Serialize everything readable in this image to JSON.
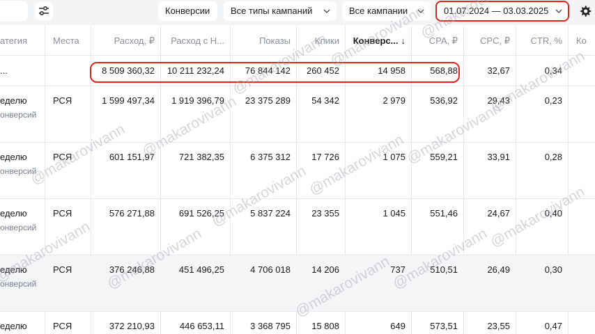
{
  "toolbar": {
    "conversions_label": "Конверсии",
    "campaign_types_label": "Все типы кампаний",
    "campaigns_label": "Все кампании",
    "date_range": "01.07.2024 — 03.03.2025"
  },
  "table": {
    "columns": [
      "атегия",
      "Места",
      "Расход, ₽",
      "Расход с Н...",
      "Показы",
      "Клики",
      "Конверс...",
      "CPA, ₽",
      "CPC, ₽",
      "CTR, %",
      "Ко"
    ],
    "sort_indicator": "↓",
    "total": {
      "strategy": "...",
      "places": "",
      "spend": "8 509 360,32",
      "spend_vat": "10 211 232,24",
      "impressions": "76 844 142",
      "clicks": "260 452",
      "conversions": "14 958",
      "cpa": "568,88",
      "cpc": "32,67",
      "ctr": "0,34"
    },
    "rows": [
      {
        "strategy": "еделю",
        "strategy_sub": "онверсий",
        "places": "РСЯ",
        "spend": "1 599 497,34",
        "spend_vat": "1 919 396,79",
        "impressions": "23 375 289",
        "clicks": "54 342",
        "conversions": "2 979",
        "cpa": "536,92",
        "cpc": "29,43",
        "ctr": "0,23"
      },
      {
        "strategy": "еделю",
        "strategy_sub": "онверсий",
        "places": "РСЯ",
        "spend": "601 151,97",
        "spend_vat": "721 382,35",
        "impressions": "6 375 312",
        "clicks": "17 726",
        "conversions": "1 075",
        "cpa": "559,21",
        "cpc": "33,91",
        "ctr": "0,28"
      },
      {
        "strategy": "еделю",
        "strategy_sub": "онверсий",
        "places": "РСЯ",
        "spend": "576 271,88",
        "spend_vat": "691 526,25",
        "impressions": "5 837 224",
        "clicks": "23 355",
        "conversions": "1 045",
        "cpa": "551,46",
        "cpc": "24,67",
        "ctr": "0,40"
      },
      {
        "strategy": "еделю",
        "strategy_sub": "онверсий",
        "places": "РСЯ",
        "spend": "376 246,88",
        "spend_vat": "451 496,25",
        "impressions": "4 706 018",
        "clicks": "14 206",
        "conversions": "737",
        "cpa": "510,51",
        "cpc": "26,49",
        "ctr": "0,30"
      },
      {
        "strategy": "еделю",
        "strategy_sub": "",
        "places": "РСЯ",
        "spend": "372 210,93",
        "spend_vat": "446 653,11",
        "impressions": "3 368 795",
        "clicks": "15 808",
        "conversions": "649",
        "cpa": "573,51",
        "cpc": "23,55",
        "ctr": "0,47"
      }
    ]
  },
  "watermark": "@makarovivann",
  "colors": {
    "highlight": "#e2231a",
    "muted_text": "#8a8f99",
    "toolbar_bg": "#f3f4f6"
  }
}
